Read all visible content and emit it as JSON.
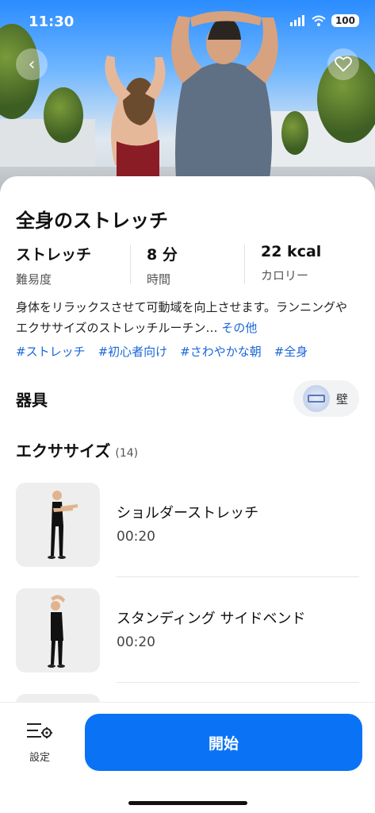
{
  "status": {
    "time": "11:30",
    "battery": "100"
  },
  "workout": {
    "title": "全身のストレッチ",
    "stats": [
      {
        "value": "ストレッチ",
        "label": "難易度"
      },
      {
        "value": "8 分",
        "label": "時間"
      },
      {
        "value": "22 kcal",
        "label": "カロリー"
      }
    ],
    "description": "身体をリラックスさせて可動域を向上させます。ランニングやエクササイズのストレッチルーチン…",
    "more_label": "その他",
    "tags": [
      "#ストレッチ",
      "#初心者向け",
      "#さわやかな朝",
      "#全身"
    ]
  },
  "equipment": {
    "title": "器具",
    "items": [
      {
        "label": "壁"
      }
    ]
  },
  "exercises": {
    "title": "エクササイズ",
    "count": "(14)",
    "items": [
      {
        "name": "ショルダーストレッチ",
        "duration": "00:20"
      },
      {
        "name": "スタンディング サイドベンド",
        "duration": "00:20"
      }
    ]
  },
  "bottom": {
    "settings_label": "設定",
    "start_label": "開始"
  },
  "colors": {
    "accent": "#0a73f5",
    "link": "#1a66d8"
  }
}
